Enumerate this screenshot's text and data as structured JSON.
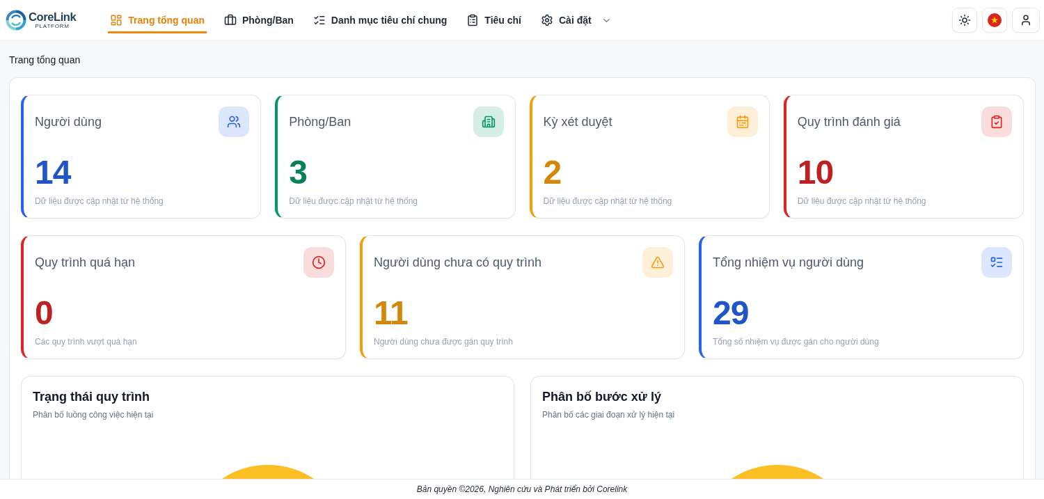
{
  "header": {
    "brand": {
      "name": "CoreLink",
      "tagline": "PLATFORM"
    },
    "nav": [
      {
        "label": "Trang tổng quan",
        "kind": "dashboard",
        "selected": true,
        "dropdown": false
      },
      {
        "label": "Phòng/Ban",
        "kind": "departments",
        "selected": false,
        "dropdown": false
      },
      {
        "label": "Danh mục tiêu chí chung",
        "kind": "checklist",
        "selected": false,
        "dropdown": false
      },
      {
        "label": "Tiêu chí",
        "kind": "criteria",
        "selected": false,
        "dropdown": false
      },
      {
        "label": "Cài đặt",
        "kind": "settings",
        "selected": false,
        "dropdown": true
      }
    ],
    "actions": [
      {
        "kind": "theme"
      },
      {
        "kind": "language"
      },
      {
        "kind": "account"
      }
    ]
  },
  "breadcrumb": "Trang tổng quan",
  "summary_rows": [
    {
      "cards": [
        {
          "kind": "users",
          "title": "Người dùng",
          "value": "14",
          "caption": "Dữ liệu được cập nhật từ hệ thống",
          "color": "#2563eb"
        },
        {
          "kind": "departments",
          "title": "Phòng/Ban",
          "value": "3",
          "caption": "Dữ liệu được cập nhật từ hệ thống",
          "color": "#059669"
        },
        {
          "kind": "periods",
          "title": "Kỳ xét duyệt",
          "value": "2",
          "caption": "Dữ liệu được cập nhật từ hệ thống",
          "color": "#f59e0b"
        },
        {
          "kind": "processes",
          "title": "Quy trình đánh giá",
          "value": "10",
          "caption": "Dữ liệu được cập nhật từ hệ thống",
          "color": "#dc2626"
        }
      ]
    },
    {
      "cards": [
        {
          "kind": "overdue",
          "title": "Quy trình quá hạn",
          "value": "0",
          "caption": "Các quy trình vượt quá hạn",
          "color": "#dc2626"
        },
        {
          "kind": "unassigned",
          "title": "Người dùng chưa có quy trình",
          "value": "11",
          "caption": "Người dùng chưa được gán quy trình",
          "color": "#f59e0b"
        },
        {
          "kind": "tasks",
          "title": "Tổng nhiệm vụ người dùng",
          "value": "29",
          "caption": "Tổng số nhiệm vụ được gán cho người dùng",
          "color": "#2563eb"
        }
      ]
    }
  ],
  "charts": [
    {
      "title": "Trạng thái quy trình",
      "subtitle": "Phân bố luồng công việc hiện tại"
    },
    {
      "title": "Phân bố bước xử lý",
      "subtitle": "Phân bố các giai đoạn xử lý hiện tại"
    }
  ],
  "footer": "Bản quyền ©2026, Nghiên cứu và Phát triển bởi Corelink"
}
